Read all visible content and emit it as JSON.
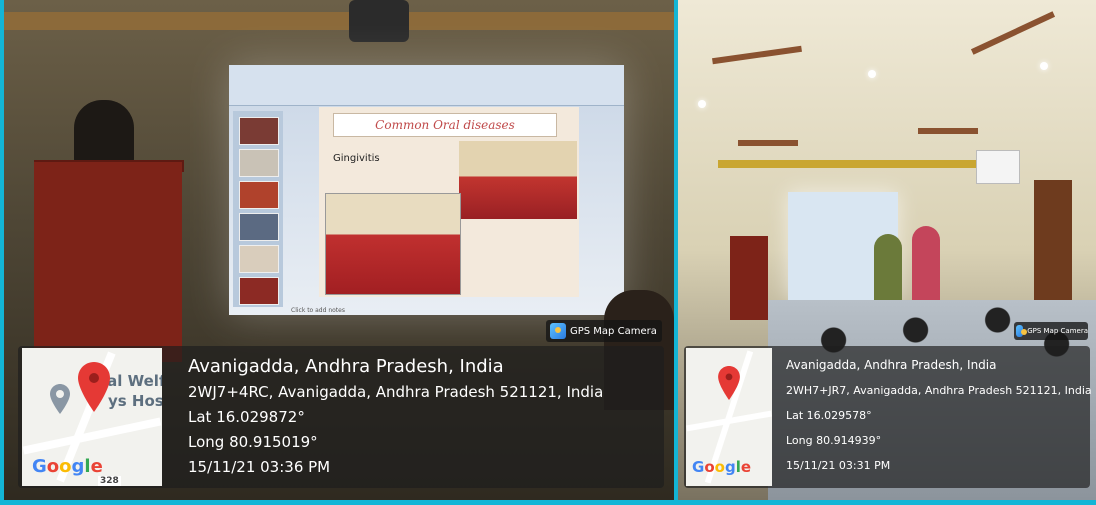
{
  "left_photo": {
    "slide": {
      "title": "Common Oral diseases",
      "subtitle": "Gingivitis",
      "notes_placeholder": "Click to add notes"
    },
    "badge_label": "GPS Map Camera",
    "map_text_line1": "ial Welf",
    "map_text_line2": "ys Host",
    "google_letters": [
      "G",
      "o",
      "o",
      "g",
      "l",
      "e"
    ],
    "road_number": "328",
    "location": {
      "place": "Avanigadda, Andhra Pradesh, India",
      "address": "2WJ7+4RC, Avanigadda, Andhra Pradesh 521121, India",
      "lat": "Lat 16.029872°",
      "long": "Long 80.915019°",
      "datetime": "15/11/21 03:36 PM"
    }
  },
  "right_photo": {
    "badge_label": "GPS Map Camera",
    "google_letters": [
      "G",
      "o",
      "o",
      "g",
      "l",
      "e"
    ],
    "location": {
      "place": "Avanigadda, Andhra Pradesh, India",
      "address": "2WH7+JR7, Avanigadda, Andhra Pradesh 521121, India",
      "lat": "Lat 16.029578°",
      "long": "Long 80.914939°",
      "datetime": "15/11/21 03:31 PM"
    }
  },
  "colors": {
    "border": "#13b5d6",
    "pin": "#e53935",
    "lectern": "#7d2318"
  }
}
